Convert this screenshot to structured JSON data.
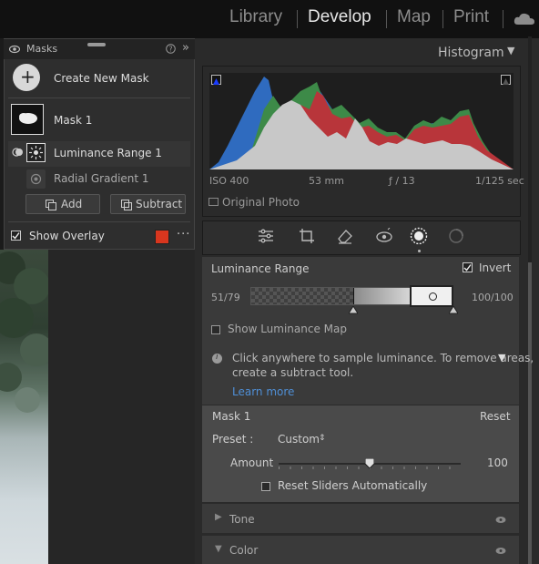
{
  "nav": {
    "items": [
      "Library",
      "Develop",
      "Map",
      "Print"
    ],
    "active": "Develop"
  },
  "masks": {
    "title": "Masks",
    "create_label": "Create New Mask",
    "mask1_label": "Mask 1",
    "lum_range_label": "Luminance Range 1",
    "radial_label": "Radial Gradient 1",
    "add_label": "Add",
    "subtract_label": "Subtract",
    "show_overlay_label": "Show Overlay",
    "overlay_color": "#d8361e"
  },
  "histogram": {
    "title": "Histogram",
    "iso": "ISO 400",
    "focal": "53 mm",
    "aperture": "ƒ / 13",
    "shutter": "1/125 sec",
    "original_photo_label": "Original Photo"
  },
  "luminance": {
    "title": "Luminance Range",
    "invert_label": "Invert",
    "left_value": "51/79",
    "right_value": "100/100",
    "show_map_label": "Show Luminance Map",
    "info_text_1": "Click anywhere to sample luminance. To remove areas,",
    "info_text_2": "create a subtract tool.",
    "learn_more": "Learn more"
  },
  "mask_panel": {
    "title": "Mask 1",
    "reset_label": "Reset",
    "preset_label": "Preset :",
    "preset_value": "Custom",
    "amount_label": "Amount",
    "amount_value": "100",
    "amount_fraction": 0.5,
    "reset_sliders_label": "Reset Sliders Automatically"
  },
  "sections": {
    "tone": "Tone",
    "color": "Color"
  }
}
